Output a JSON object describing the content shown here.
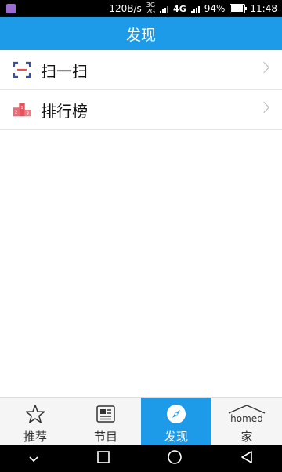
{
  "status_bar": {
    "speed": "120B/s",
    "network_small_top": "3G",
    "network_small_bottom": "2G",
    "network": "4G",
    "battery": "94%",
    "battery_level": 0.94,
    "time": "11:48"
  },
  "header": {
    "title": "发现"
  },
  "list": [
    {
      "label": "扫一扫",
      "icon": "scan-icon"
    },
    {
      "label": "排行榜",
      "icon": "podium-icon"
    }
  ],
  "tabs": [
    {
      "label": "推荐",
      "icon": "star-icon",
      "active": false
    },
    {
      "label": "节目",
      "icon": "newspaper-icon",
      "active": false
    },
    {
      "label": "发现",
      "icon": "compass-icon",
      "active": true
    },
    {
      "label": "家",
      "icon": "homed-logo-icon",
      "logo_text": "homed",
      "active": false
    }
  ],
  "colors": {
    "accent": "#1e9be8",
    "scan_icon": "#3a4fa3",
    "podium_icon": "#e8505b"
  }
}
